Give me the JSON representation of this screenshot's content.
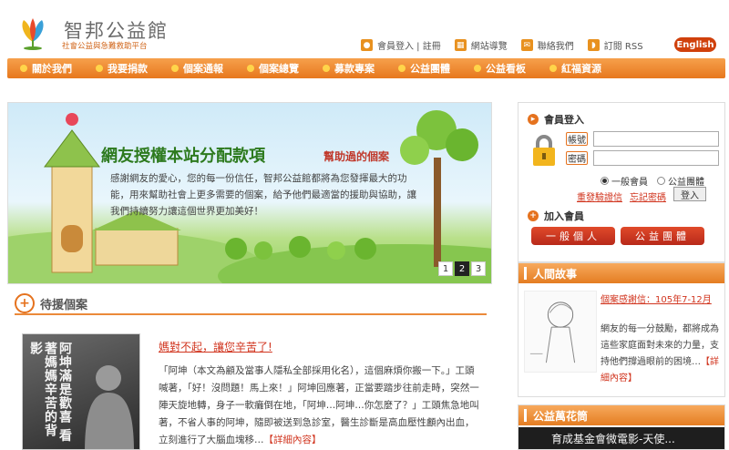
{
  "header": {
    "site_name": "智邦公益館",
    "slogan": "社會公益與急難救助平台",
    "toplinks": [
      {
        "label": "會員登入 | 註冊",
        "icon": "user-icon"
      },
      {
        "label": "網站導覽",
        "icon": "sitemap-icon"
      },
      {
        "label": "聯絡我們",
        "icon": "mail-icon"
      },
      {
        "label": "訂閱 RSS",
        "icon": "rss-icon"
      }
    ],
    "lang_button": "English"
  },
  "nav": {
    "items": [
      "關於我們",
      "我要捐款",
      "個案通報",
      "個案總覽",
      "募款專案",
      "公益團體",
      "公益看板",
      "紅福資源"
    ]
  },
  "banner": {
    "title": "網友授權本站分配款項",
    "subtitle": "幫助過的個案",
    "text": "感謝網友的愛心，您的每一份信任，智邦公益館都將為您發揮最大的功能，用來幫助社會上更多需要的個案，給予他們最適當的援助與協助，讓我們持續努力讓這個世界更加美好！",
    "pages": [
      "1",
      "2",
      "3"
    ],
    "active_page": "2"
  },
  "waiting_section": {
    "title": "待援個案",
    "case": {
      "image_text": "阿坤滿是歡喜 看著媽媽辛苦的背影",
      "title": "媽對不起，讓您辛苦了!",
      "text": "「阿坤（本文為顧及當事人隱私全部採用化名），這個麻煩你搬一下。」工頭喊著，「好！沒問題！馬上來！」阿坤回應著，正當要踏步往前走時，突然一陣天旋地轉，身子一軟癱倒在地，「阿坤…阿坤…你怎麼了？」工頭焦急地叫著，不省人事的阿坤，隨即被送到急診室，醫生診斷是高血壓性顱內出血，立刻進行了大腦血塊移…",
      "more": "【詳細內容】"
    }
  },
  "login": {
    "title": "會員登入",
    "account_label": "帳號",
    "password_label": "密碼",
    "radio_general": "一般會員",
    "radio_group": "公益團體",
    "resend_link": "重發驗證信",
    "forgot_link": "忘記密碼",
    "login_button": "登入",
    "join_title": "加入會員",
    "join_general": "一般個人",
    "join_group": "公益團體"
  },
  "stories": {
    "title": "人間故事",
    "story_title": "個案感謝信：105年7-12月",
    "text": "網友的每一分鼓勵，都將成為這些家庭面對未來的力量，支持他們撐過眼前的困境…",
    "more": "【詳細內容】"
  },
  "album": {
    "title": "公益萬花筒",
    "video_caption": "育成基金會微電影-天使..."
  },
  "colors": {
    "accent": "#e5721e",
    "link_red": "#d1351f",
    "nav_start": "#f6a04c",
    "nav_end": "#e7781d"
  }
}
